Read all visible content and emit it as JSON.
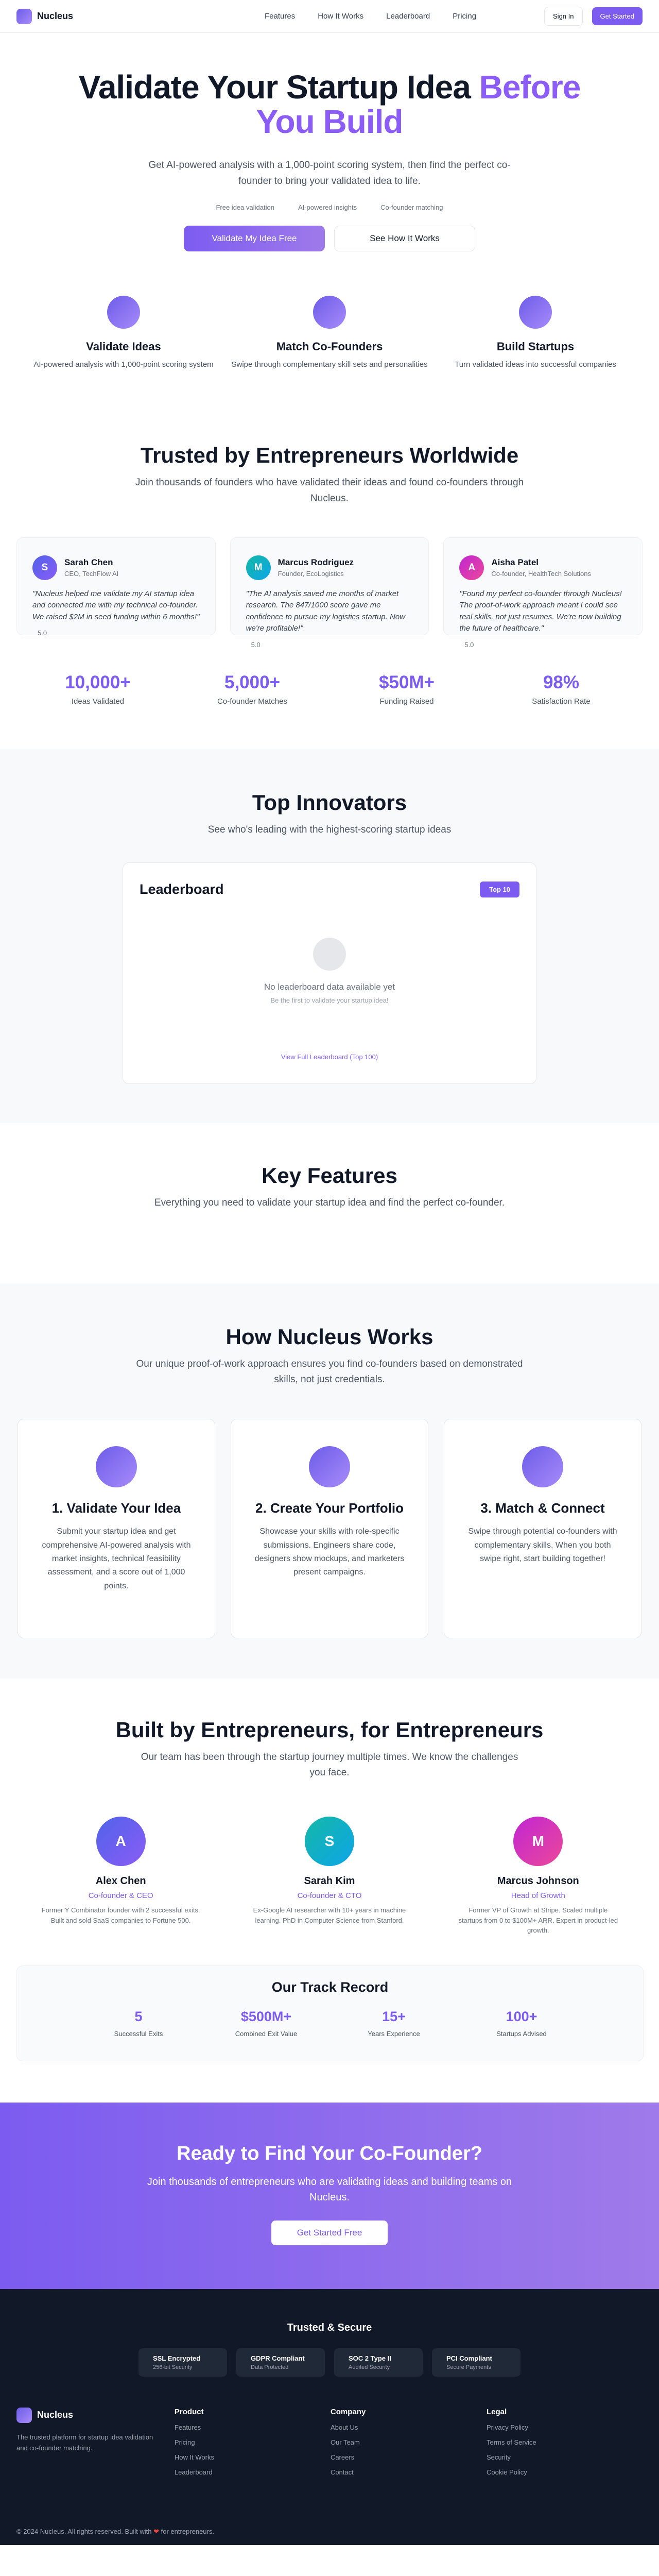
{
  "nav": {
    "brand": "Nucleus",
    "links": [
      "Features",
      "How It Works",
      "Leaderboard",
      "Pricing"
    ],
    "sign_in": "Sign In",
    "get_started": "Get Started"
  },
  "hero": {
    "title_main": "Validate Your Startup Idea",
    "title_accent_1": "Before",
    "title_accent_2": "You Build",
    "subtitle": "Get AI-powered analysis with a 1,000-point scoring system, then find the perfect co-founder to bring your validated idea to life.",
    "tags": [
      "Free idea validation",
      "AI-powered insights",
      "Co-founder matching"
    ],
    "primary_cta": "Validate My Idea Free",
    "secondary_cta": "See How It Works"
  },
  "features3": [
    {
      "title": "Validate Ideas",
      "desc": "AI-powered analysis with 1,000-point scoring system"
    },
    {
      "title": "Match Co-Founders",
      "desc": "Swipe through complementary skill sets and personalities"
    },
    {
      "title": "Build Startups",
      "desc": "Turn validated ideas into successful companies"
    }
  ],
  "trusted": {
    "title": "Trusted by Entrepreneurs Worldwide",
    "subtitle": "Join thousands of founders who have validated their ideas and found co-founders through Nucleus.",
    "testimonials": [
      {
        "initial": "S",
        "name": "Sarah Chen",
        "role": "CEO, TechFlow AI",
        "quote": "\"Nucleus helped me validate my AI startup idea and connected me with my technical co-founder. We raised $2M in seed funding within 6 months!\"",
        "rating": "5.0",
        "color": "#4f63e8"
      },
      {
        "initial": "M",
        "name": "Marcus Rodriguez",
        "role": "Founder, EcoLogistics",
        "quote": "\"The AI analysis saved me months of market research. The 847/1000 score gave me confidence to pursue my logistics startup. Now we're profitable!\"",
        "rating": "5.0",
        "color": "#14b8a6"
      },
      {
        "initial": "A",
        "name": "Aisha Patel",
        "role": "Co-founder, HealthTech Solutions",
        "quote": "\"Found my perfect co-founder through Nucleus! The proof-of-work approach meant I could see real skills, not just resumes. We're now building the future of healthcare.\"",
        "rating": "5.0",
        "color": "#c026d3"
      }
    ],
    "stats": [
      {
        "num": "10,000+",
        "label": "Ideas Validated"
      },
      {
        "num": "5,000+",
        "label": "Co-founder Matches"
      },
      {
        "num": "$50M+",
        "label": "Funding Raised"
      },
      {
        "num": "98%",
        "label": "Satisfaction Rate"
      }
    ]
  },
  "innovators": {
    "title": "Top Innovators",
    "subtitle": "See who's leading with the highest-scoring startup ideas",
    "board_title": "Leaderboard",
    "badge": "Top 10",
    "empty_title": "No leaderboard data available yet",
    "empty_sub": "Be the first to validate your startup idea!",
    "link": "View Full Leaderboard (Top 100)"
  },
  "key_features": {
    "title": "Key Features",
    "subtitle": "Everything you need to validate your startup idea and find the perfect co-founder."
  },
  "how": {
    "title": "How Nucleus Works",
    "subtitle": "Our unique proof-of-work approach ensures you find co-founders based on demonstrated skills, not just credentials.",
    "steps": [
      {
        "title": "1. Validate Your Idea",
        "desc": "Submit your startup idea and get comprehensive AI-powered analysis with market insights, technical feasibility assessment, and a score out of 1,000 points."
      },
      {
        "title": "2. Create Your Portfolio",
        "desc": "Showcase your skills with role-specific submissions. Engineers share code, designers show mockups, and marketers present campaigns."
      },
      {
        "title": "3. Match & Connect",
        "desc": "Swipe through potential co-founders with complementary skills. When you both swipe right, start building together!"
      }
    ]
  },
  "team": {
    "title": "Built by Entrepreneurs, for Entrepreneurs",
    "subtitle": "Our team has been through the startup journey multiple times. We know the challenges you face.",
    "members": [
      {
        "initial": "A",
        "name": "Alex Chen",
        "role": "Co-founder & CEO",
        "bio": "Former Y Combinator founder with 2 successful exits. Built and sold SaaS companies to Fortune 500.",
        "color": "#4f63e8"
      },
      {
        "initial": "S",
        "name": "Sarah Kim",
        "role": "Co-founder & CTO",
        "bio": "Ex-Google AI researcher with 10+ years in machine learning. PhD in Computer Science from Stanford.",
        "color": "#14b8a6"
      },
      {
        "initial": "M",
        "name": "Marcus Johnson",
        "role": "Head of Growth",
        "bio": "Former VP of Growth at Stripe. Scaled multiple startups from 0 to $100M+ ARR. Expert in product-led growth.",
        "color": "#c026d3"
      }
    ],
    "track_title": "Our Track Record",
    "track": [
      {
        "num": "5",
        "label": "Successful Exits"
      },
      {
        "num": "$500M+",
        "label": "Combined Exit Value"
      },
      {
        "num": "15+",
        "label": "Years Experience"
      },
      {
        "num": "100+",
        "label": "Startups Advised"
      }
    ]
  },
  "cta": {
    "title": "Ready to Find Your Co-Founder?",
    "subtitle": "Join thousands of entrepreneurs who are validating ideas and building teams on Nucleus.",
    "button": "Get Started Free"
  },
  "footer": {
    "secure_title": "Trusted & Secure",
    "badges": [
      {
        "title": "SSL Encrypted",
        "sub": "256-bit Security"
      },
      {
        "title": "GDPR Compliant",
        "sub": "Data Protected"
      },
      {
        "title": "SOC 2 Type II",
        "sub": "Audited Security"
      },
      {
        "title": "PCI Compliant",
        "sub": "Secure Payments"
      }
    ],
    "brand": "Nucleus",
    "tagline": "The trusted platform for startup idea validation and co-founder matching.",
    "cols": [
      {
        "title": "Product",
        "links": [
          "Features",
          "Pricing",
          "How It Works",
          "Leaderboard"
        ]
      },
      {
        "title": "Company",
        "links": [
          "About Us",
          "Our Team",
          "Careers",
          "Contact"
        ]
      },
      {
        "title": "Legal",
        "links": [
          "Privacy Policy",
          "Terms of Service",
          "Security",
          "Cookie Policy"
        ]
      }
    ],
    "copyright_prefix": "© 2024 Nucleus. All rights reserved. Built with",
    "heart": "❤",
    "copyright_suffix": "for entrepreneurs."
  }
}
